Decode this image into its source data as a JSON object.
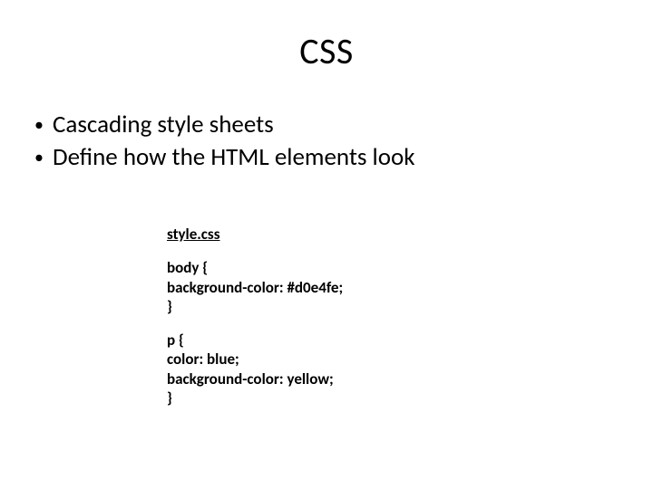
{
  "title": "CSS",
  "bullets": [
    "Cascading style sheets",
    "Define how the HTML elements look"
  ],
  "code": {
    "filename": "style.css",
    "block1": {
      "l1": "body {",
      "l2": "background-color: #d0e4fe;",
      "l3": "}"
    },
    "block2": {
      "l1": "p {",
      "l2": "color: blue;",
      "l3": "background-color: yellow;",
      "l4": "}"
    }
  }
}
